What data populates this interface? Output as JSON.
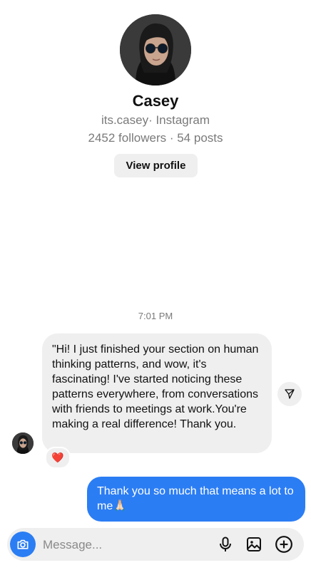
{
  "profile": {
    "name": "Casey",
    "handle_line": "its.casey· Instagram",
    "stats_line": "2452 followers · 54 posts",
    "view_profile_label": "View profile"
  },
  "conversation": {
    "timestamp": "7:01 PM",
    "incoming": {
      "text": "\"Hi! I just finished your section on human thinking patterns, and wow, it's fascinating! I've started noticing these patterns everywhere, from conversations with friends to meetings at work.You're making a real difference! Thank you.",
      "reaction": "❤️"
    },
    "outgoing": {
      "text": "Thank you so much that means a lot to me🙏🏻"
    }
  },
  "composer": {
    "placeholder": "Message..."
  },
  "colors": {
    "accent": "#2b7df4",
    "bubble_gray": "#efefef"
  },
  "icons": {
    "camera": "camera-icon",
    "mic": "microphone-icon",
    "gallery": "gallery-icon",
    "plus": "plus-circle-icon",
    "share": "send-icon"
  }
}
